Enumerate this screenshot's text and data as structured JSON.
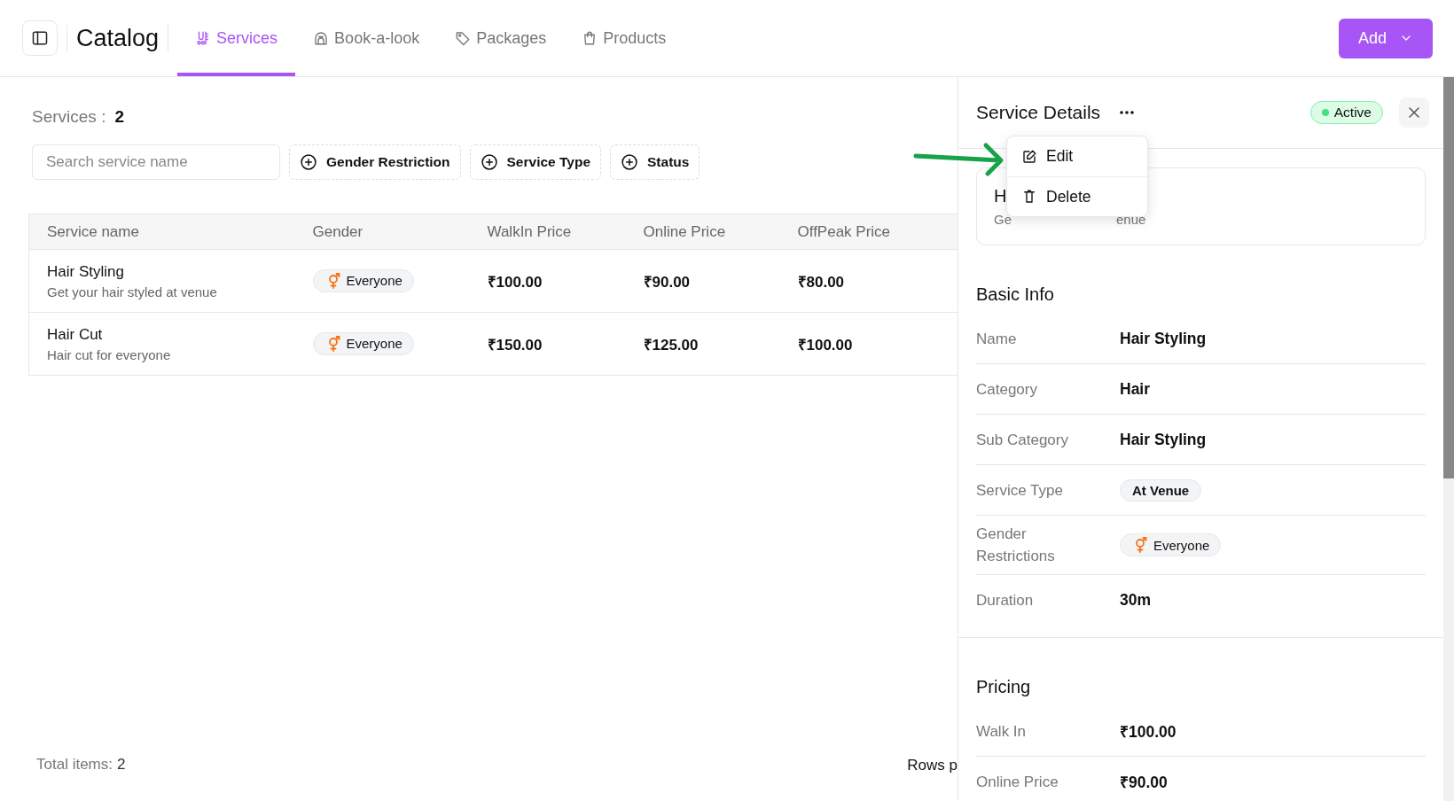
{
  "header": {
    "title": "Catalog",
    "tabs": [
      {
        "label": "Services",
        "selected": true
      },
      {
        "label": "Book-a-look",
        "selected": false
      },
      {
        "label": "Packages",
        "selected": false
      },
      {
        "label": "Products",
        "selected": false
      }
    ],
    "add_button": "Add"
  },
  "list": {
    "count_label": "Services :",
    "count": "2",
    "search": {
      "placeholder": "Search service name"
    },
    "filters": [
      "Gender Restriction",
      "Service Type",
      "Status"
    ],
    "table": {
      "columns": [
        "Service name",
        "Gender",
        "WalkIn Price",
        "Online Price",
        "OffPeak Price"
      ],
      "rows": [
        {
          "name": "Hair Styling",
          "description": "Get your hair styled at venue",
          "gender": "Everyone",
          "walkin": "₹100.00",
          "online": "₹90.00",
          "offpeak": "₹80.00"
        },
        {
          "name": "Hair Cut",
          "description": "Hair cut for everyone",
          "gender": "Everyone",
          "walkin": "₹150.00",
          "online": "₹125.00",
          "offpeak": "₹100.00"
        }
      ]
    },
    "total_label": "Total items:",
    "total": "2",
    "rows_per_page": "Rows p"
  },
  "details": {
    "title": "Service Details",
    "status": "Active",
    "card": {
      "title": "H",
      "subtitle_start": "Ge",
      "subtitle_end": "enue"
    },
    "menu": [
      "Edit",
      "Delete"
    ],
    "sections": [
      {
        "title": "Basic Info",
        "fields": [
          {
            "label": "Name",
            "value": "Hair Styling",
            "kind": "text"
          },
          {
            "label": "Category",
            "value": "Hair",
            "kind": "text"
          },
          {
            "label": "Sub Category",
            "value": "Hair Styling",
            "kind": "text"
          },
          {
            "label": "Service Type",
            "value": "At Venue",
            "kind": "chip"
          },
          {
            "label": "Gender Restrictions",
            "value": "Everyone",
            "kind": "gender"
          },
          {
            "label": "Duration",
            "value": "30m",
            "kind": "text"
          }
        ]
      },
      {
        "title": "Pricing",
        "fields": [
          {
            "label": "Walk In",
            "value": "₹100.00",
            "kind": "text"
          },
          {
            "label": "Online Price",
            "value": "₹90.00",
            "kind": "text"
          }
        ]
      }
    ]
  }
}
